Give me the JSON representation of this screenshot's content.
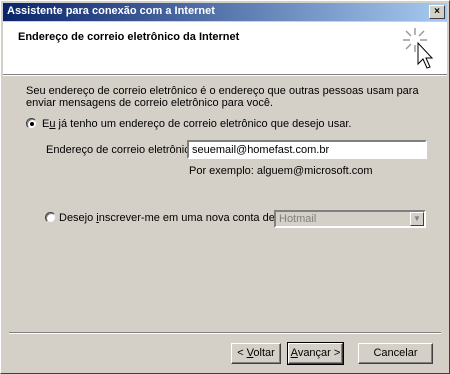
{
  "window": {
    "title": "Assistente para conexão com a Internet",
    "close_label": "×"
  },
  "header": {
    "title": "Endereço de correio eletrônico da Internet"
  },
  "description": "Seu endereço de correio eletrônico é o endereço que outras pessoas usam para enviar mensagens de correio eletrônico para você.",
  "option_existing": {
    "label_pre": "E",
    "label_accel": "u",
    "label_post": " já tenho um endereço de correio eletrônico que desejo usar.",
    "selected": true,
    "email_label": "Endereço de correio eletrônico:",
    "email_value": "seuemail@homefast.com.br",
    "example": "Por exemplo: alguem@microsoft.com"
  },
  "option_new": {
    "label_pre": "Desejo ",
    "label_accel": "i",
    "label_post": "nscrever-me em uma nova conta de:",
    "selected": false,
    "provider": "Hotmail"
  },
  "buttons": {
    "back_pre": "< ",
    "back_accel": "V",
    "back_post": "oltar",
    "next_accel": "A",
    "next_post": "vançar >",
    "cancel": "Cancelar"
  }
}
